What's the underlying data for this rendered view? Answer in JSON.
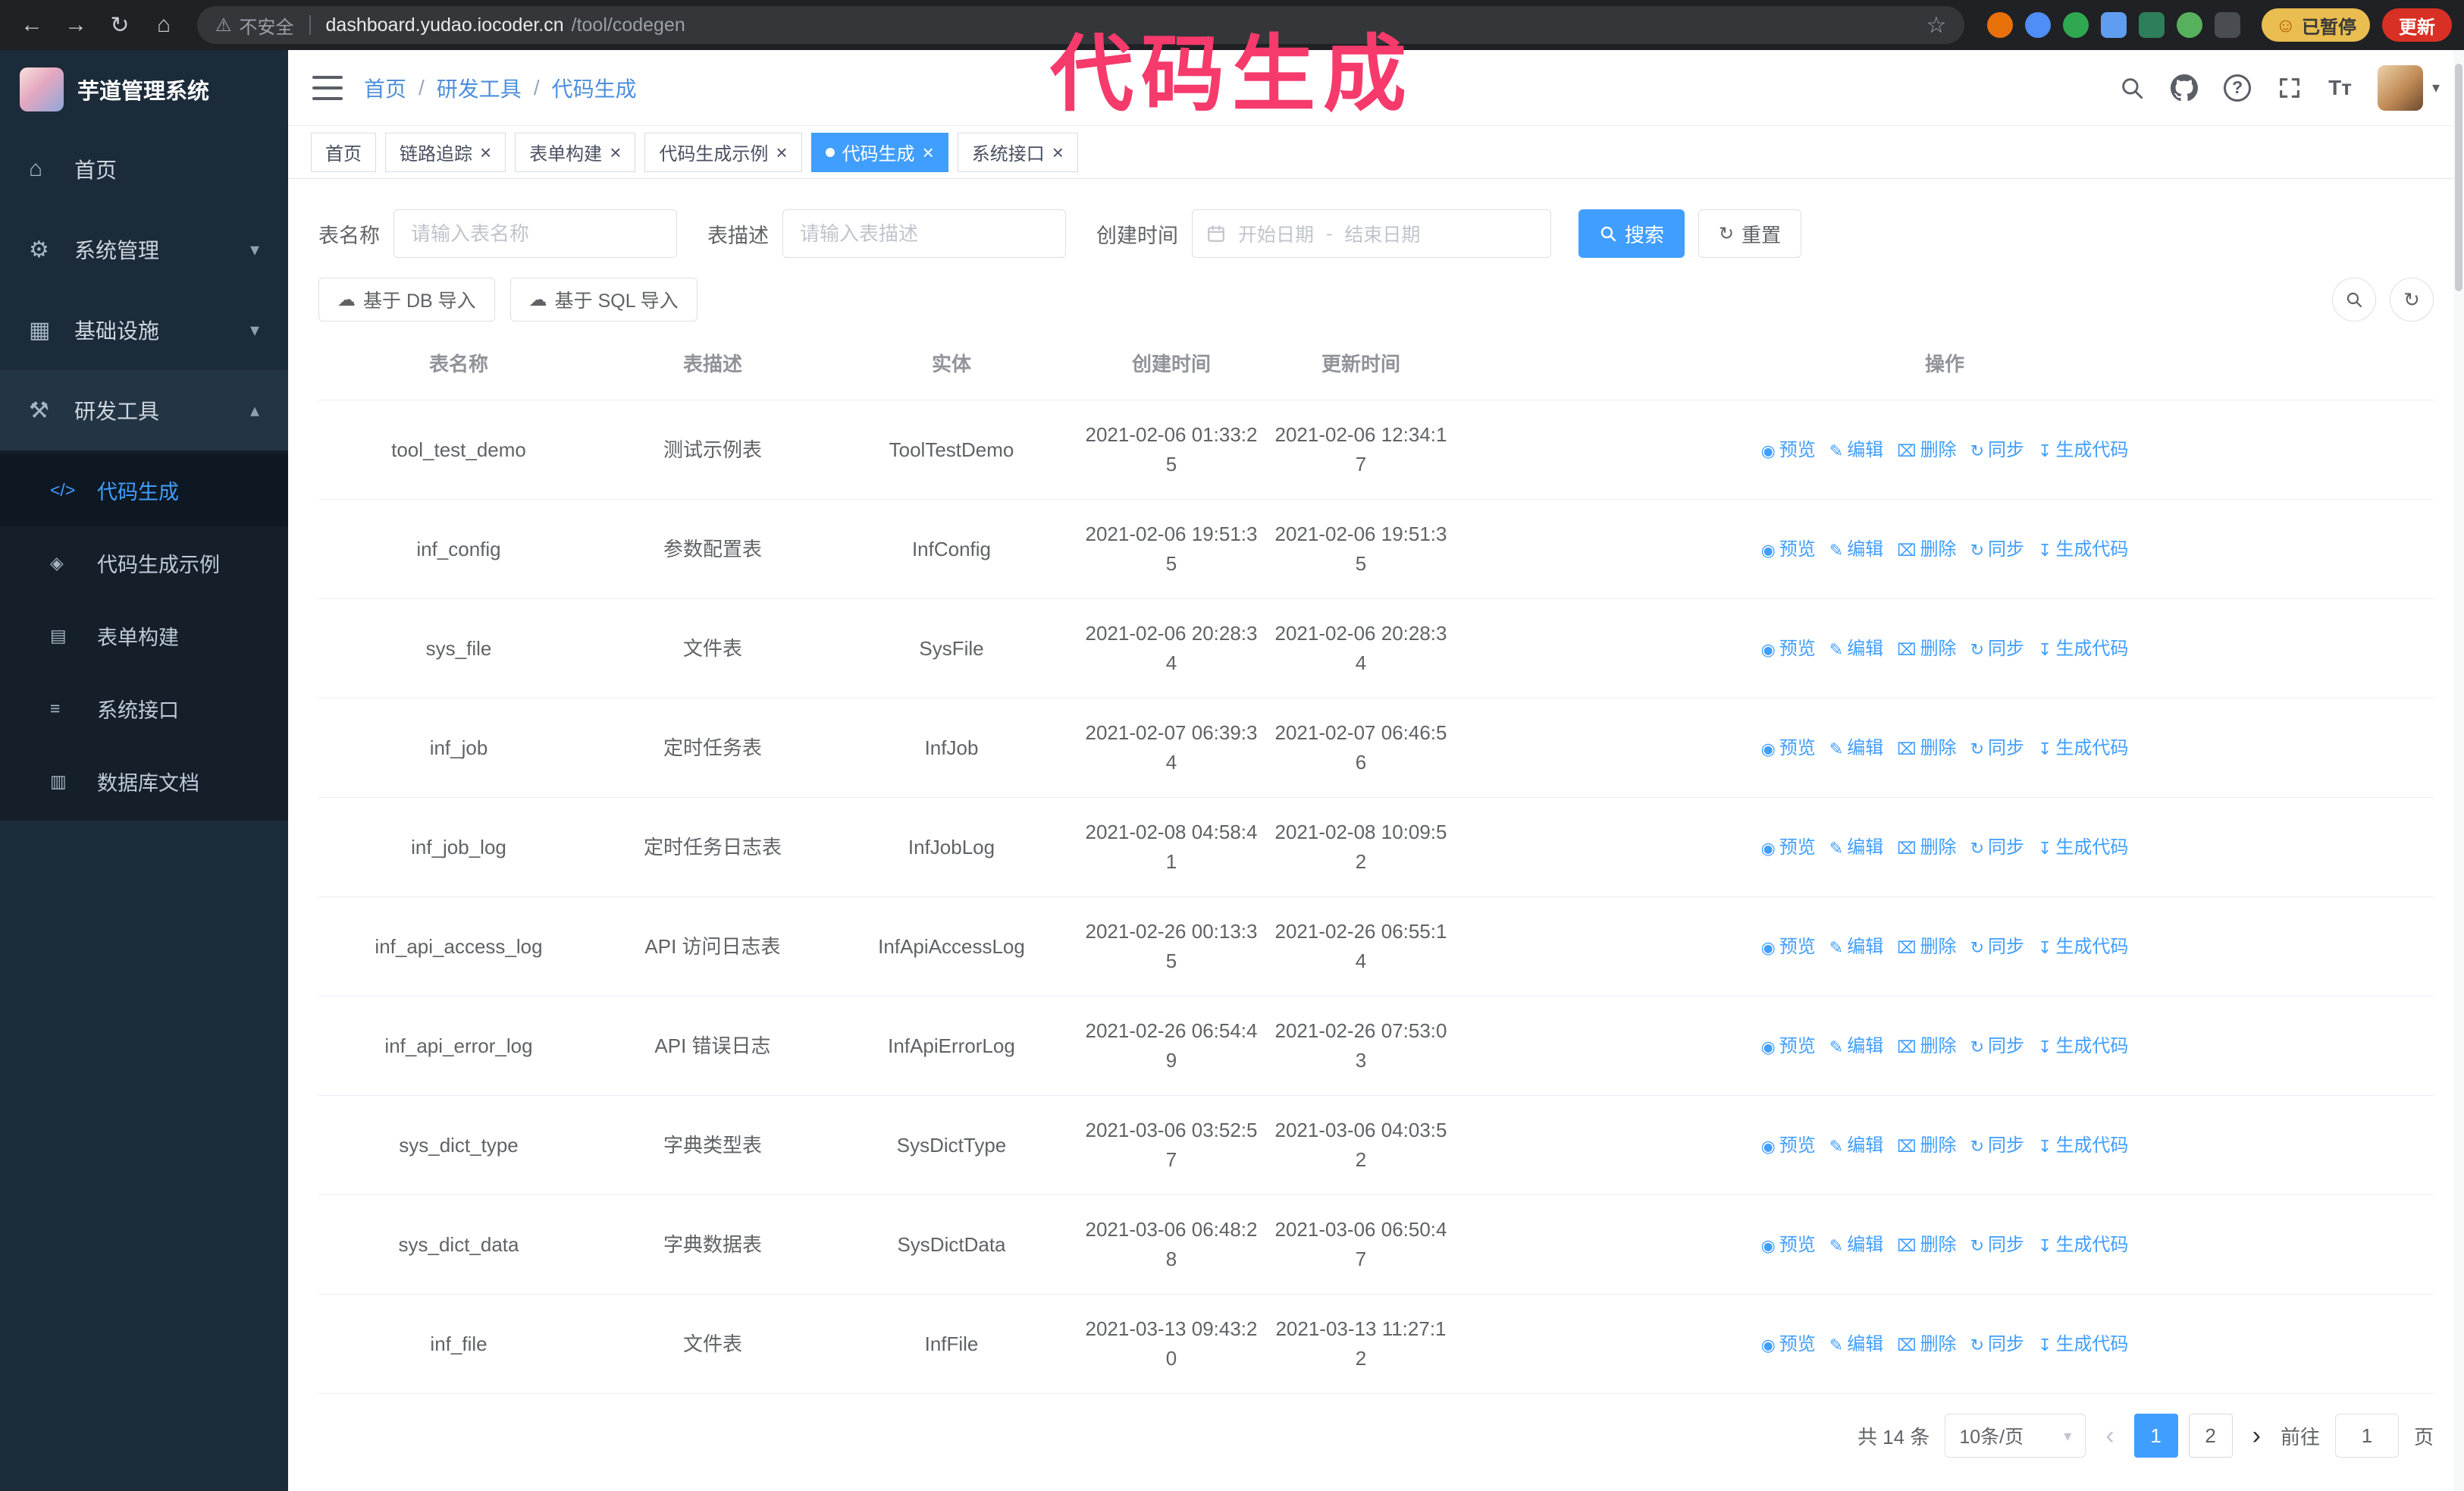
{
  "annotation": {
    "text": "代码生成",
    "color": "#f63a6b"
  },
  "browser": {
    "security_label": "不安全",
    "url": {
      "host": "dashboard.yudao.iocoder.cn",
      "path": "/tool/codegen"
    },
    "extensions": [
      {
        "name": "fox-extension-icon",
        "color": "#e8710a",
        "shape": "circle"
      },
      {
        "name": "drop-extension-icon",
        "color": "#4f8df7",
        "shape": "circle"
      },
      {
        "name": "check-extension-icon",
        "color": "#2fa84f",
        "shape": "circle"
      },
      {
        "name": "people-extension-icon",
        "color": "#5f9df0",
        "shape": "square"
      },
      {
        "name": "card-extension-icon",
        "color": "#2e7d5b",
        "shape": "square"
      },
      {
        "name": "leaf-extension-icon",
        "color": "#57b15c",
        "shape": "circle"
      },
      {
        "name": "puzzle-extension-icon",
        "color": "#494c50",
        "shape": "square"
      }
    ],
    "paused_badge": {
      "label": "已暂停",
      "bg": "#e9bd4f"
    },
    "update_button": {
      "label": "更新",
      "bg": "#d93025"
    }
  },
  "sidebar": {
    "logo_title": "芋道管理系统",
    "menu": [
      {
        "id": "home",
        "label": "首页",
        "icon": "home-icon"
      },
      {
        "id": "system",
        "label": "系统管理",
        "icon": "gear-icon",
        "chevron": "down"
      },
      {
        "id": "infra",
        "label": "基础设施",
        "icon": "infra-icon",
        "chevron": "down"
      },
      {
        "id": "devtools",
        "label": "研发工具",
        "icon": "tools-icon",
        "chevron": "up",
        "expanded": true,
        "children": [
          {
            "id": "codegen",
            "label": "代码生成",
            "icon": "code-icon",
            "active": true
          },
          {
            "id": "codegen-example",
            "label": "代码生成示例",
            "icon": "example-icon"
          },
          {
            "id": "form-builder",
            "label": "表单构建",
            "icon": "form-icon"
          },
          {
            "id": "api",
            "label": "系统接口",
            "icon": "api-icon"
          },
          {
            "id": "db-doc",
            "label": "数据库文档",
            "icon": "db-doc-icon"
          }
        ]
      }
    ]
  },
  "header": {
    "breadcrumb": [
      "首页",
      "研发工具",
      "代码生成"
    ],
    "breadcrumb_separator": "/"
  },
  "tabs": [
    {
      "id": "home",
      "label": "首页",
      "closable": false,
      "active": false
    },
    {
      "id": "trace",
      "label": "链路追踪",
      "closable": true,
      "active": false
    },
    {
      "id": "form-builder",
      "label": "表单构建",
      "closable": true,
      "active": false
    },
    {
      "id": "codegen-example",
      "label": "代码生成示例",
      "closable": true,
      "active": false
    },
    {
      "id": "codegen",
      "label": "代码生成",
      "closable": true,
      "active": true
    },
    {
      "id": "api",
      "label": "系统接口",
      "closable": true,
      "active": false
    }
  ],
  "filters": {
    "table_name_label": "表名称",
    "table_name_placeholder": "请输入表名称",
    "table_desc_label": "表描述",
    "table_desc_placeholder": "请输入表描述",
    "create_time_label": "创建时间",
    "date_start_placeholder": "开始日期",
    "date_separator": "-",
    "date_end_placeholder": "结束日期",
    "search_button": "搜索",
    "reset_button": "重置"
  },
  "toolbar": {
    "import_db_button": "基于 DB 导入",
    "import_sql_button": "基于 SQL 导入"
  },
  "table": {
    "columns": [
      "表名称",
      "表描述",
      "实体",
      "创建时间",
      "更新时间",
      "操作"
    ],
    "row_actions": [
      "预览",
      "编辑",
      "删除",
      "同步",
      "生成代码"
    ],
    "rows": [
      {
        "name": "tool_test_demo",
        "desc": "测试示例表",
        "entity": "ToolTestDemo",
        "created": "2021-02-06 01:33:25",
        "updated": "2021-02-06 12:34:17"
      },
      {
        "name": "inf_config",
        "desc": "参数配置表",
        "entity": "InfConfig",
        "created": "2021-02-06 19:51:35",
        "updated": "2021-02-06 19:51:35"
      },
      {
        "name": "sys_file",
        "desc": "文件表",
        "entity": "SysFile",
        "created": "2021-02-06 20:28:34",
        "updated": "2021-02-06 20:28:34"
      },
      {
        "name": "inf_job",
        "desc": "定时任务表",
        "entity": "InfJob",
        "created": "2021-02-07 06:39:34",
        "updated": "2021-02-07 06:46:56"
      },
      {
        "name": "inf_job_log",
        "desc": "定时任务日志表",
        "entity": "InfJobLog",
        "created": "2021-02-08 04:58:41",
        "updated": "2021-02-08 10:09:52"
      },
      {
        "name": "inf_api_access_log",
        "desc": "API 访问日志表",
        "entity": "InfApiAccessLog",
        "created": "2021-02-26 00:13:35",
        "updated": "2021-02-26 06:55:14"
      },
      {
        "name": "inf_api_error_log",
        "desc": "API 错误日志",
        "entity": "InfApiErrorLog",
        "created": "2021-02-26 06:54:49",
        "updated": "2021-02-26 07:53:03"
      },
      {
        "name": "sys_dict_type",
        "desc": "字典类型表",
        "entity": "SysDictType",
        "created": "2021-03-06 03:52:57",
        "updated": "2021-03-06 04:03:52"
      },
      {
        "name": "sys_dict_data",
        "desc": "字典数据表",
        "entity": "SysDictData",
        "created": "2021-03-06 06:48:28",
        "updated": "2021-03-06 06:50:47"
      },
      {
        "name": "inf_file",
        "desc": "文件表",
        "entity": "InfFile",
        "created": "2021-03-13 09:43:20",
        "updated": "2021-03-13 11:27:12"
      }
    ]
  },
  "pagination": {
    "total_text": "共 14 条",
    "page_size": "10条/页",
    "pages": [
      "1",
      "2"
    ],
    "active_page": "1",
    "goto_label": "前往",
    "goto_value": "1",
    "goto_suffix": "页"
  }
}
